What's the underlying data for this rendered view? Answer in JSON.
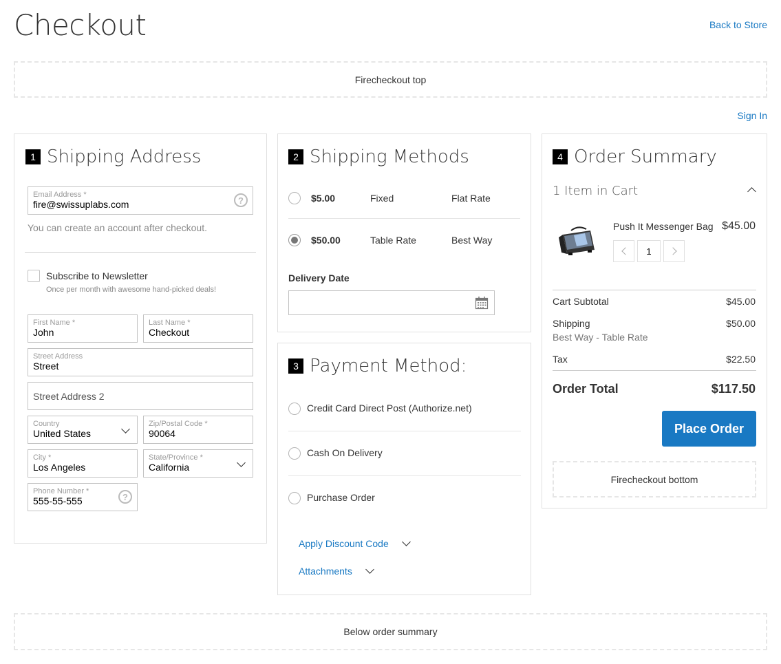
{
  "header": {
    "title": "Checkout",
    "back_link": "Back to Store",
    "sign_in": "Sign In"
  },
  "blocks": {
    "top": "Firecheckout top",
    "below": "Below order summary",
    "bottom": "Firecheckout bottom"
  },
  "shipping_address": {
    "step": "1",
    "title": "Shipping Address",
    "email": {
      "label": "Email Address *",
      "value": "fire@swissuplabs.com"
    },
    "account_note": "You can create an account after checkout.",
    "newsletter": {
      "label": "Subscribe to Newsletter",
      "note": "Once per month with awesome hand-picked deals!"
    },
    "first_name": {
      "label": "First Name *",
      "value": "John"
    },
    "last_name": {
      "label": "Last Name *",
      "value": "Checkout"
    },
    "street": {
      "label": "Street Address",
      "value": "Street"
    },
    "street2": {
      "placeholder": "Street Address 2"
    },
    "country": {
      "label": "Country",
      "value": "United States"
    },
    "zip": {
      "label": "Zip/Postal Code *",
      "value": "90064"
    },
    "city": {
      "label": "City *",
      "value": "Los Angeles"
    },
    "state": {
      "label": "State/Province *",
      "value": "California"
    },
    "phone": {
      "label": "Phone Number *",
      "value": "555-55-555"
    }
  },
  "shipping_methods": {
    "step": "2",
    "title": "Shipping Methods",
    "options": [
      {
        "price": "$5.00",
        "method": "Fixed",
        "carrier": "Flat Rate",
        "selected": false
      },
      {
        "price": "$50.00",
        "method": "Table Rate",
        "carrier": "Best Way",
        "selected": true
      }
    ],
    "delivery_date_label": "Delivery Date"
  },
  "payment": {
    "step": "3",
    "title": "Payment Method:",
    "options": [
      {
        "label": "Credit Card Direct Post (Authorize.net)"
      },
      {
        "label": "Cash On Delivery"
      },
      {
        "label": "Purchase Order"
      }
    ],
    "discount_link": "Apply Discount Code",
    "attachments_link": "Attachments"
  },
  "summary": {
    "step": "4",
    "title": "Order Summary",
    "items_in_cart": "1 Item in Cart",
    "item": {
      "name": "Push It Messenger Bag",
      "price": "$45.00",
      "qty": "1"
    },
    "cart_subtotal": {
      "label": "Cart Subtotal",
      "value": "$45.00"
    },
    "shipping": {
      "label": "Shipping",
      "sub": "Best Way - Table Rate",
      "value": "$50.00"
    },
    "tax": {
      "label": "Tax",
      "value": "$22.50"
    },
    "order_total": {
      "label": "Order Total",
      "value": "$117.50"
    },
    "place_order": "Place Order"
  },
  "colors": {
    "accent": "#1979c3",
    "border": "#e0e0e0",
    "dashed": "#e6e6e6"
  }
}
